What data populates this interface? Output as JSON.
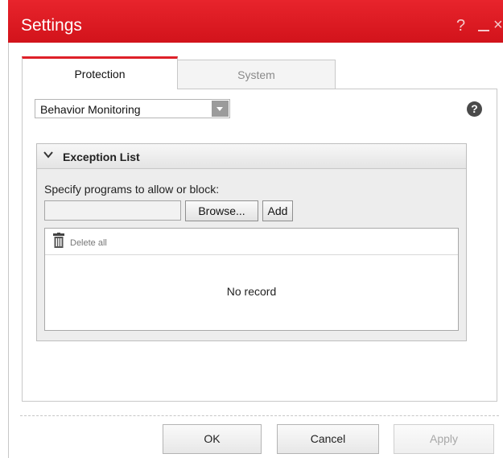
{
  "window": {
    "title": "Settings",
    "help_label": "?",
    "close_label": "×"
  },
  "tabs": [
    {
      "label": "Protection",
      "active": true
    },
    {
      "label": "System",
      "active": false
    }
  ],
  "feature_select": {
    "selected": "Behavior Monitoring"
  },
  "exception_list": {
    "title": "Exception List",
    "instruction": "Specify programs to allow or block:",
    "path_value": "",
    "browse_label": "Browse...",
    "add_label": "Add",
    "delete_all_label": "Delete all",
    "empty_message": "No record"
  },
  "footer": {
    "ok_label": "OK",
    "cancel_label": "Cancel",
    "apply_label": "Apply"
  },
  "colors": {
    "accent": "#de2028",
    "titlebar": "#d2131b"
  }
}
